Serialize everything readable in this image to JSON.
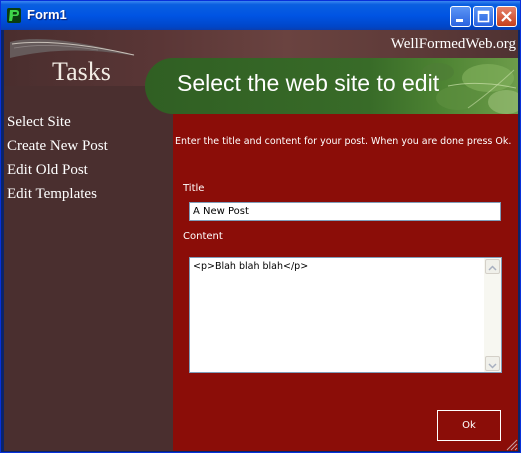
{
  "window": {
    "title": "Form1"
  },
  "brand": "WellFormedWeb.org",
  "sidebar": {
    "title": "Tasks",
    "items": [
      {
        "label": "Select Site"
      },
      {
        "label": "Create New Post"
      },
      {
        "label": "Edit Old Post"
      },
      {
        "label": "Edit Templates"
      }
    ]
  },
  "header": {
    "title": "Select the web site to edit"
  },
  "form": {
    "instructions": "Enter the title and content for your post. When you are done press Ok.",
    "title_label": "Title",
    "title_value": "A New Post",
    "content_label": "Content",
    "content_value": "<p>Blah blah blah</p>",
    "ok_label": "Ok"
  },
  "colors": {
    "sidebar": "#4a2f2f",
    "main_panel": "#8b0d08",
    "header_band": "#386b28",
    "titlebar": "#0054e3"
  }
}
